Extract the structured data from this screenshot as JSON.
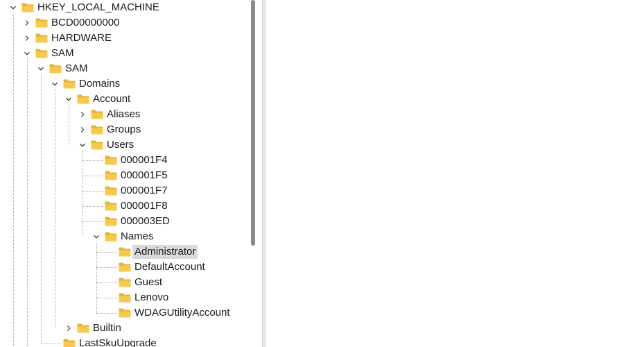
{
  "tree": {
    "nodes": [
      {
        "label": "HKEY_LOCAL_MACHINE",
        "depth": 0,
        "expander": "expanded",
        "selected": false
      },
      {
        "label": "BCD00000000",
        "depth": 1,
        "expander": "collapsed",
        "selected": false
      },
      {
        "label": "HARDWARE",
        "depth": 1,
        "expander": "collapsed",
        "selected": false
      },
      {
        "label": "SAM",
        "depth": 1,
        "expander": "expanded",
        "selected": false
      },
      {
        "label": "SAM",
        "depth": 2,
        "expander": "expanded",
        "selected": false
      },
      {
        "label": "Domains",
        "depth": 3,
        "expander": "expanded",
        "selected": false
      },
      {
        "label": "Account",
        "depth": 4,
        "expander": "expanded",
        "selected": false
      },
      {
        "label": "Aliases",
        "depth": 5,
        "expander": "collapsed",
        "selected": false
      },
      {
        "label": "Groups",
        "depth": 5,
        "expander": "collapsed",
        "selected": false
      },
      {
        "label": "Users",
        "depth": 5,
        "expander": "expanded",
        "selected": false
      },
      {
        "label": "000001F4",
        "depth": 6,
        "expander": "none",
        "selected": false
      },
      {
        "label": "000001F5",
        "depth": 6,
        "expander": "none",
        "selected": false
      },
      {
        "label": "000001F7",
        "depth": 6,
        "expander": "none",
        "selected": false
      },
      {
        "label": "000001F8",
        "depth": 6,
        "expander": "none",
        "selected": false
      },
      {
        "label": "000003ED",
        "depth": 6,
        "expander": "none",
        "selected": false
      },
      {
        "label": "Names",
        "depth": 6,
        "expander": "expanded",
        "selected": false
      },
      {
        "label": "Administrator",
        "depth": 7,
        "expander": "none",
        "selected": true
      },
      {
        "label": "DefaultAccount",
        "depth": 7,
        "expander": "none",
        "selected": false
      },
      {
        "label": "Guest",
        "depth": 7,
        "expander": "none",
        "selected": false
      },
      {
        "label": "Lenovo",
        "depth": 7,
        "expander": "none",
        "selected": false
      },
      {
        "label": "WDAGUtilityAccount",
        "depth": 7,
        "expander": "none",
        "selected": false
      },
      {
        "label": "Builtin",
        "depth": 4,
        "expander": "collapsed",
        "selected": false
      },
      {
        "label": "LastSkuUpgrade",
        "depth": 3,
        "expander": "none",
        "selected": false
      }
    ]
  },
  "icons": {
    "folder": "folder-icon",
    "expanded": "chevron-down-icon",
    "collapsed": "chevron-right-icon"
  },
  "colors": {
    "folder": "#f6c94c",
    "folder_tab": "#e8b232",
    "selection": "#d9d9d9",
    "scroll_thumb": "#8a8a8a",
    "tree_line": "#a8a8a8"
  }
}
